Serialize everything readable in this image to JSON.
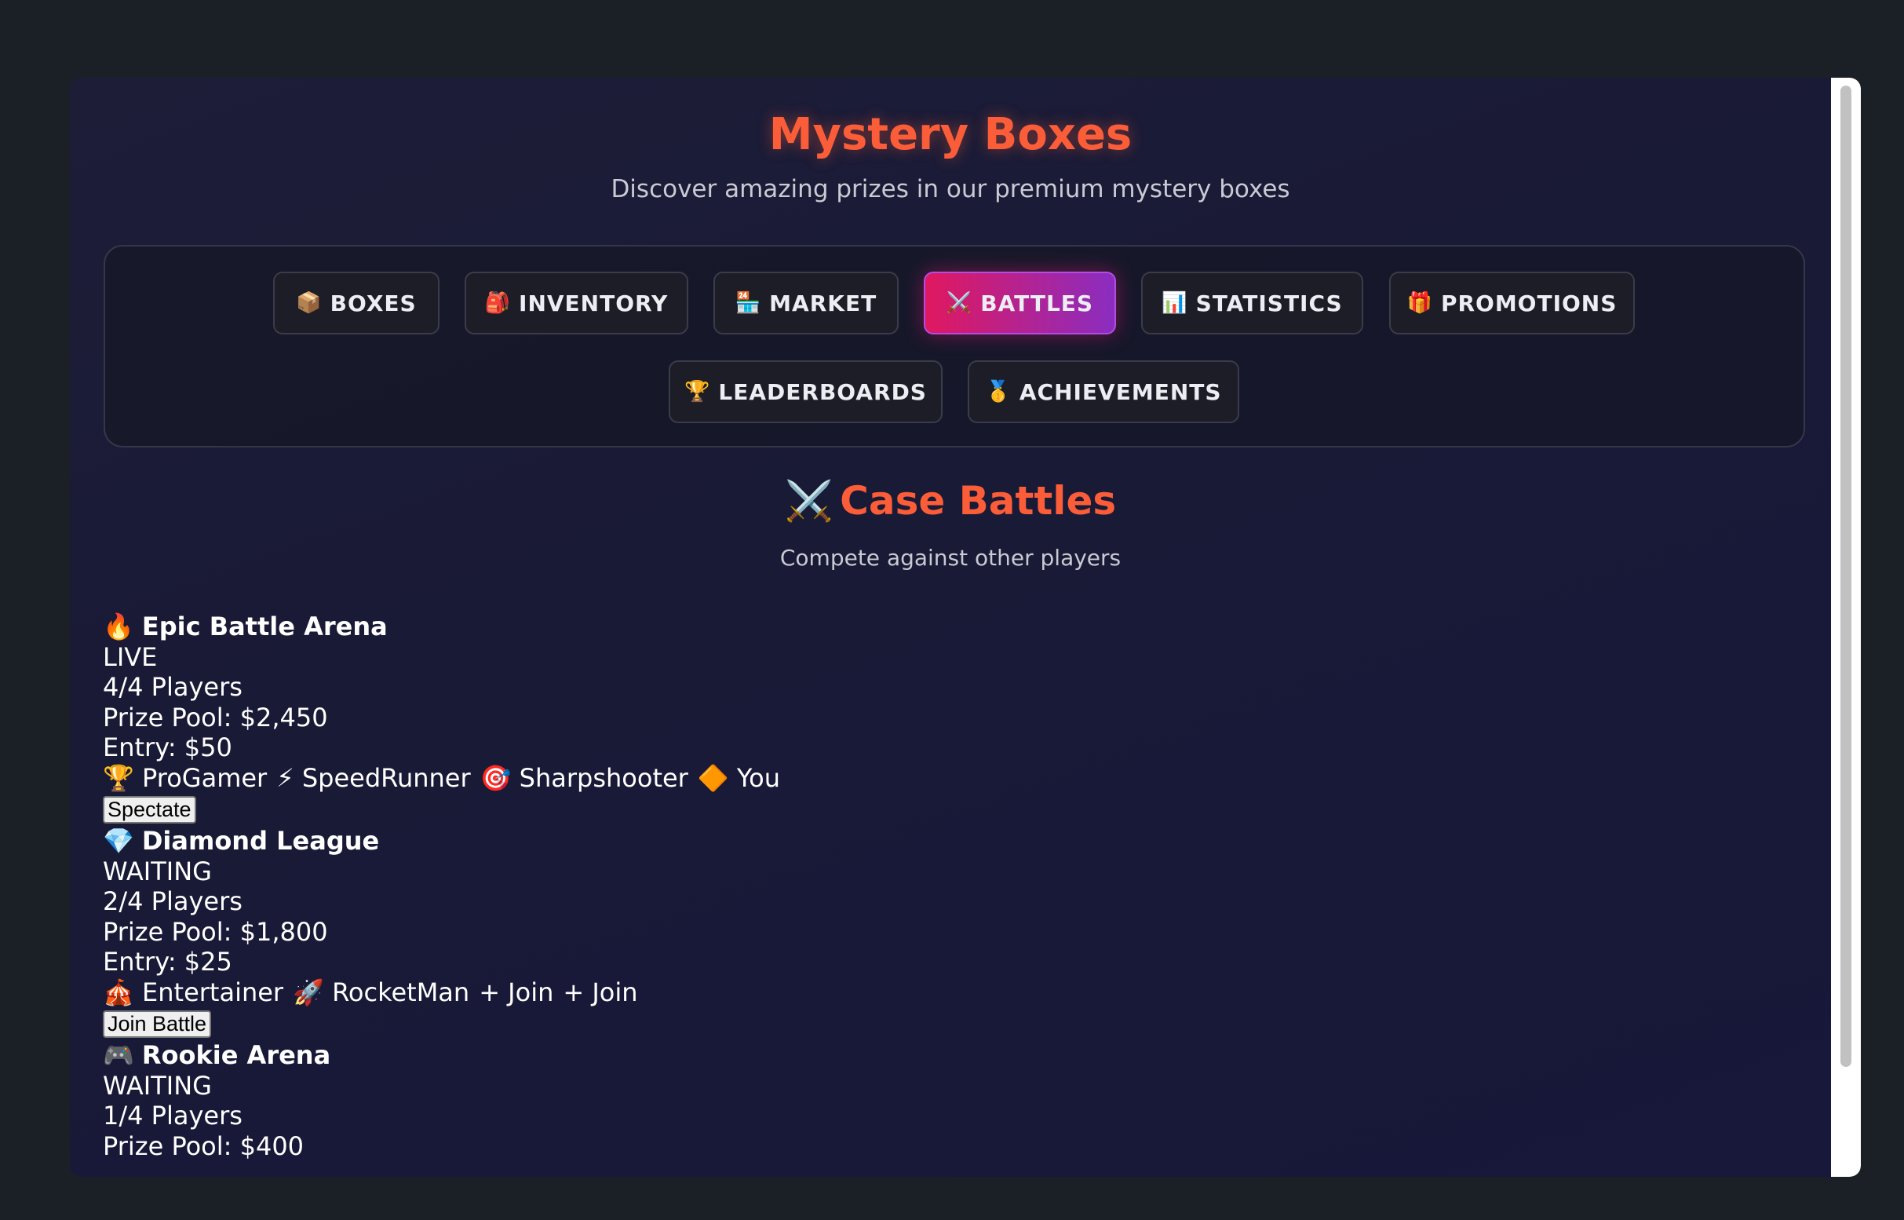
{
  "header": {
    "title": "Mystery Boxes",
    "subtitle": "Discover amazing prizes in our premium mystery boxes"
  },
  "nav": {
    "items": [
      {
        "icon": "📦",
        "label": "BOXES"
      },
      {
        "icon": "🎒",
        "label": "INVENTORY"
      },
      {
        "icon": "🏪",
        "label": "MARKET"
      },
      {
        "icon": "⚔️",
        "label": "BATTLES"
      },
      {
        "icon": "📊",
        "label": "STATISTICS"
      },
      {
        "icon": "🎁",
        "label": "PROMOTIONS"
      },
      {
        "icon": "🏆",
        "label": "LEADERBOARDS"
      },
      {
        "icon": "🥇",
        "label": "ACHIEVEMENTS"
      }
    ],
    "active": "BATTLES"
  },
  "section": {
    "icon": "⚔️",
    "title": "Case Battles",
    "subtitle": "Compete against other players"
  },
  "battles": [
    {
      "icon": "🔥",
      "name": "Epic Battle Arena",
      "status": "LIVE",
      "players": "4/4 Players",
      "prize": "Prize Pool: $2,450",
      "entry": "Entry: $50",
      "participants": [
        {
          "icon": "🏆",
          "name": "ProGamer"
        },
        {
          "icon": "⚡",
          "name": "SpeedRunner"
        },
        {
          "icon": "🎯",
          "name": "Sharpshooter"
        },
        {
          "icon": "🔶",
          "name": "You"
        }
      ],
      "action": "Spectate"
    },
    {
      "icon": "💎",
      "name": "Diamond League",
      "status": "WAITING",
      "players": "2/4 Players",
      "prize": "Prize Pool: $1,800",
      "entry": "Entry: $25",
      "participants": [
        {
          "icon": "🎪",
          "name": "Entertainer"
        },
        {
          "icon": "🚀",
          "name": "RocketMan"
        },
        {
          "icon": "+",
          "name": "Join"
        },
        {
          "icon": "+",
          "name": "Join"
        }
      ],
      "action": "Join Battle"
    },
    {
      "icon": "🎮",
      "name": "Rookie Arena",
      "status": "WAITING",
      "players": "1/4 Players",
      "prize": "Prize Pool: $400"
    }
  ],
  "colors": {
    "accent": "#fb5d38",
    "active_tab_start": "#e0185f",
    "active_tab_end": "#8a2dc0",
    "background": "#1b2027"
  }
}
